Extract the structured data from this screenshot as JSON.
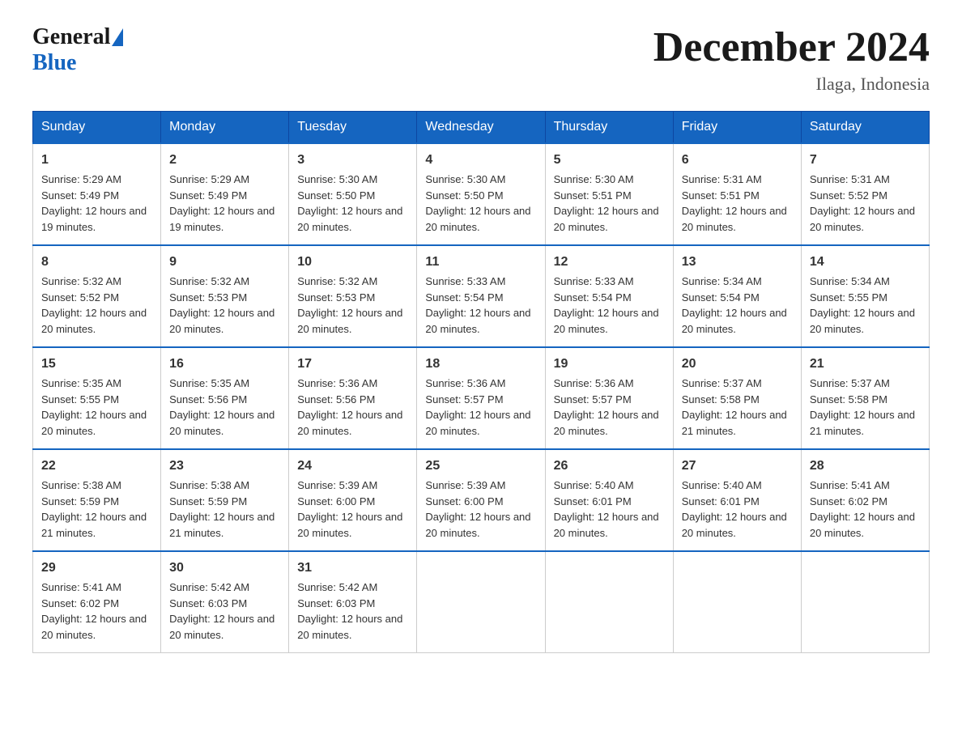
{
  "header": {
    "logo_general": "General",
    "logo_blue": "Blue",
    "title": "December 2024",
    "location": "Ilaga, Indonesia"
  },
  "days_of_week": [
    "Sunday",
    "Monday",
    "Tuesday",
    "Wednesday",
    "Thursday",
    "Friday",
    "Saturday"
  ],
  "weeks": [
    [
      {
        "day": "1",
        "sunrise": "5:29 AM",
        "sunset": "5:49 PM",
        "daylight": "12 hours and 19 minutes."
      },
      {
        "day": "2",
        "sunrise": "5:29 AM",
        "sunset": "5:49 PM",
        "daylight": "12 hours and 19 minutes."
      },
      {
        "day": "3",
        "sunrise": "5:30 AM",
        "sunset": "5:50 PM",
        "daylight": "12 hours and 20 minutes."
      },
      {
        "day": "4",
        "sunrise": "5:30 AM",
        "sunset": "5:50 PM",
        "daylight": "12 hours and 20 minutes."
      },
      {
        "day": "5",
        "sunrise": "5:30 AM",
        "sunset": "5:51 PM",
        "daylight": "12 hours and 20 minutes."
      },
      {
        "day": "6",
        "sunrise": "5:31 AM",
        "sunset": "5:51 PM",
        "daylight": "12 hours and 20 minutes."
      },
      {
        "day": "7",
        "sunrise": "5:31 AM",
        "sunset": "5:52 PM",
        "daylight": "12 hours and 20 minutes."
      }
    ],
    [
      {
        "day": "8",
        "sunrise": "5:32 AM",
        "sunset": "5:52 PM",
        "daylight": "12 hours and 20 minutes."
      },
      {
        "day": "9",
        "sunrise": "5:32 AM",
        "sunset": "5:53 PM",
        "daylight": "12 hours and 20 minutes."
      },
      {
        "day": "10",
        "sunrise": "5:32 AM",
        "sunset": "5:53 PM",
        "daylight": "12 hours and 20 minutes."
      },
      {
        "day": "11",
        "sunrise": "5:33 AM",
        "sunset": "5:54 PM",
        "daylight": "12 hours and 20 minutes."
      },
      {
        "day": "12",
        "sunrise": "5:33 AM",
        "sunset": "5:54 PM",
        "daylight": "12 hours and 20 minutes."
      },
      {
        "day": "13",
        "sunrise": "5:34 AM",
        "sunset": "5:54 PM",
        "daylight": "12 hours and 20 minutes."
      },
      {
        "day": "14",
        "sunrise": "5:34 AM",
        "sunset": "5:55 PM",
        "daylight": "12 hours and 20 minutes."
      }
    ],
    [
      {
        "day": "15",
        "sunrise": "5:35 AM",
        "sunset": "5:55 PM",
        "daylight": "12 hours and 20 minutes."
      },
      {
        "day": "16",
        "sunrise": "5:35 AM",
        "sunset": "5:56 PM",
        "daylight": "12 hours and 20 minutes."
      },
      {
        "day": "17",
        "sunrise": "5:36 AM",
        "sunset": "5:56 PM",
        "daylight": "12 hours and 20 minutes."
      },
      {
        "day": "18",
        "sunrise": "5:36 AM",
        "sunset": "5:57 PM",
        "daylight": "12 hours and 20 minutes."
      },
      {
        "day": "19",
        "sunrise": "5:36 AM",
        "sunset": "5:57 PM",
        "daylight": "12 hours and 20 minutes."
      },
      {
        "day": "20",
        "sunrise": "5:37 AM",
        "sunset": "5:58 PM",
        "daylight": "12 hours and 21 minutes."
      },
      {
        "day": "21",
        "sunrise": "5:37 AM",
        "sunset": "5:58 PM",
        "daylight": "12 hours and 21 minutes."
      }
    ],
    [
      {
        "day": "22",
        "sunrise": "5:38 AM",
        "sunset": "5:59 PM",
        "daylight": "12 hours and 21 minutes."
      },
      {
        "day": "23",
        "sunrise": "5:38 AM",
        "sunset": "5:59 PM",
        "daylight": "12 hours and 21 minutes."
      },
      {
        "day": "24",
        "sunrise": "5:39 AM",
        "sunset": "6:00 PM",
        "daylight": "12 hours and 20 minutes."
      },
      {
        "day": "25",
        "sunrise": "5:39 AM",
        "sunset": "6:00 PM",
        "daylight": "12 hours and 20 minutes."
      },
      {
        "day": "26",
        "sunrise": "5:40 AM",
        "sunset": "6:01 PM",
        "daylight": "12 hours and 20 minutes."
      },
      {
        "day": "27",
        "sunrise": "5:40 AM",
        "sunset": "6:01 PM",
        "daylight": "12 hours and 20 minutes."
      },
      {
        "day": "28",
        "sunrise": "5:41 AM",
        "sunset": "6:02 PM",
        "daylight": "12 hours and 20 minutes."
      }
    ],
    [
      {
        "day": "29",
        "sunrise": "5:41 AM",
        "sunset": "6:02 PM",
        "daylight": "12 hours and 20 minutes."
      },
      {
        "day": "30",
        "sunrise": "5:42 AM",
        "sunset": "6:03 PM",
        "daylight": "12 hours and 20 minutes."
      },
      {
        "day": "31",
        "sunrise": "5:42 AM",
        "sunset": "6:03 PM",
        "daylight": "12 hours and 20 minutes."
      },
      null,
      null,
      null,
      null
    ]
  ],
  "labels": {
    "sunrise": "Sunrise: ",
    "sunset": "Sunset: ",
    "daylight": "Daylight: "
  }
}
